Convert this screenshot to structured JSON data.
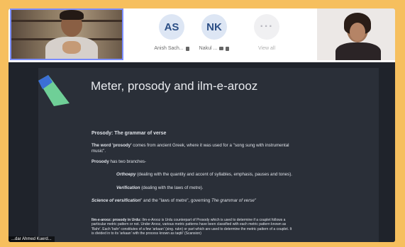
{
  "participants": [
    {
      "initials": "AS",
      "name": "Anish Sach...",
      "bg": "#dde6f4"
    },
    {
      "initials": "NK",
      "name": "Nakul ...",
      "bg": "#dde6f4"
    }
  ],
  "view_all": {
    "glyph": "···",
    "label": "View all"
  },
  "presenter_name": "...dar Ahmed Kuerd...",
  "slide": {
    "title": "Meter, prosody and ilm-e-arooz",
    "heading": "Prosody: The grammar of verse",
    "line1_bold": "The word 'prosody'",
    "line1_rest": " comes from ancient Greek, where it was used for a \"song sung with instrumental",
    "line1_cont": "music\".",
    "line2_bold": "Prosody",
    "line2_rest": " has two branches-",
    "orthoepy_label": "Orthoepy",
    "orthoepy_text": " (dealing with the quantity and accent of syllables, emphasis, pauses and tones).",
    "verification_label": "Verification",
    "verification_text": " (dealing with the laws of metre).",
    "science_label": "Science of versification",
    "science_text": "\" and the \"laws of metre\", governing ",
    "science_italic": "The grammar of verse\"",
    "ilm_bold": "Ilm-e-arooz: prosody in Urdu:",
    "ilm_text1": " Ilm-e-Arooz is Urdu counterpart of Prosody which is used to determine if a couplet follows a",
    "ilm_text2": "particular metric pattern or not. Under Arooz, various metric patterns have been classified with each metric pattern known as",
    "ilm_text3": "'Bahr'. Each 'bahr' constitutes of a few 'arkaan' (sing. rukn) or part which are used to determine the metric pattern of a couplet. It",
    "ilm_text4": "is divided in to its 'arkaan' with the process known as taqtii' (Scansion)"
  }
}
